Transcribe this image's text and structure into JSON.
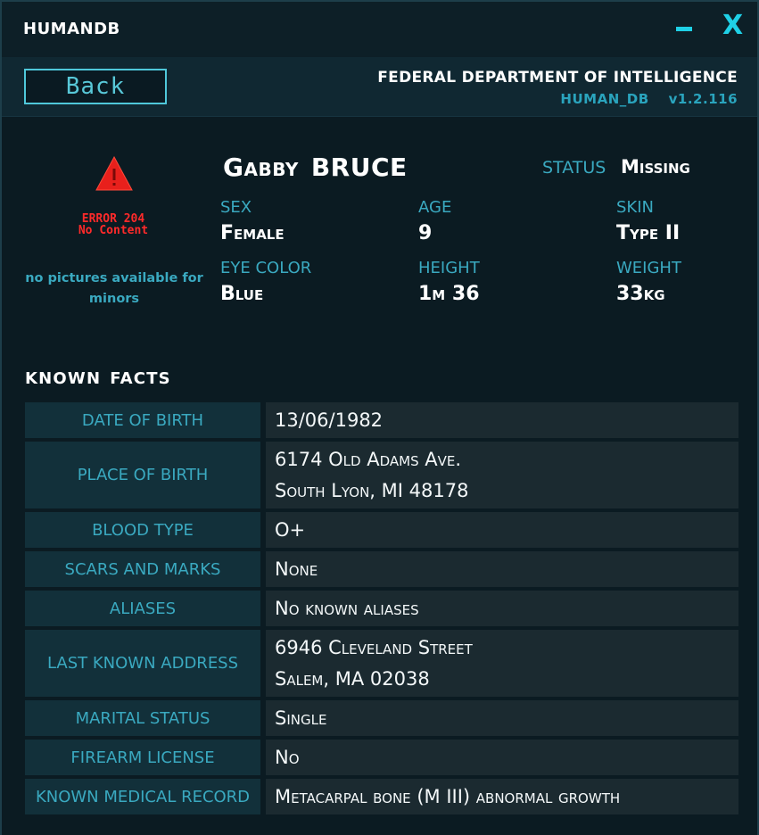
{
  "app": {
    "title": "HUMANDB"
  },
  "window_controls": {
    "minimize": "–",
    "close": "X"
  },
  "header": {
    "back_label": "Back",
    "agency": "FEDERAL DEPARTMENT OF INTELLIGENCE",
    "db_name": "HUMAN_DB",
    "version": "v1.2.116"
  },
  "photo": {
    "error_line1": "ERROR 204",
    "error_line2": "No Content",
    "note": "no pictures available for minors"
  },
  "person": {
    "first_name": "Gabby",
    "last_name": "BRUCE",
    "status_label": "STATUS",
    "status_value": "Missing",
    "attributes": {
      "sex": {
        "label": "SEX",
        "value": "Female"
      },
      "age": {
        "label": "AGE",
        "value": "9"
      },
      "skin": {
        "label": "SKIN",
        "value": "Type II"
      },
      "eye": {
        "label": "EYE COLOR",
        "value": "Blue"
      },
      "height": {
        "label": "HEIGHT",
        "value": "1m 36"
      },
      "weight": {
        "label": "WEIGHT",
        "value": "33kg"
      }
    }
  },
  "facts": {
    "title_1": "KNOWN",
    "title_2": "FACTS",
    "rows": [
      {
        "label": "DATE OF BIRTH",
        "lines": [
          "13/06/1982"
        ]
      },
      {
        "label": "PLACE OF BIRTH",
        "lines": [
          "6174 Old Adams Ave.",
          "South Lyon, MI 48178"
        ]
      },
      {
        "label": "BLOOD TYPE",
        "lines": [
          "O+"
        ]
      },
      {
        "label": "SCARS AND MARKS",
        "lines": [
          "None"
        ]
      },
      {
        "label": "ALIASES",
        "lines": [
          "No known aliases"
        ]
      },
      {
        "label": "LAST KNOWN ADDRESS",
        "lines": [
          "6946 Cleveland Street",
          "Salem, MA 02038"
        ]
      },
      {
        "label": "MARITAL STATUS",
        "lines": [
          "Single"
        ]
      },
      {
        "label": "FIREARM LICENSE",
        "lines": [
          "No"
        ]
      },
      {
        "label": "KNOWN MEDICAL RECORD",
        "lines": [
          "Metacarpal bone (M III) abnormal growth"
        ]
      }
    ]
  },
  "colors": {
    "accent": "#1fd0e6",
    "label": "#3aa9c0",
    "error": "#ff2a2a",
    "background": "#0b1b22"
  }
}
